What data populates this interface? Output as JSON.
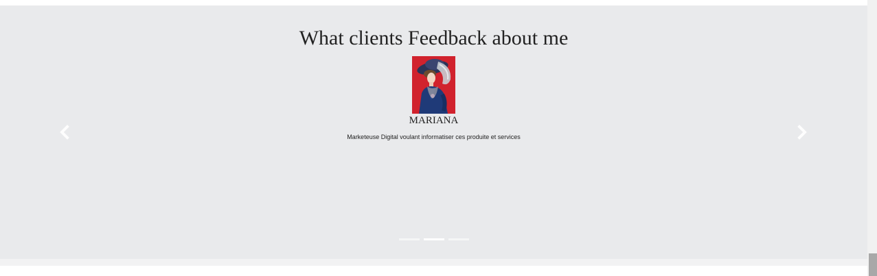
{
  "section": {
    "title": "What clients Feedback about me"
  },
  "testimonial": {
    "name": "MARIANA",
    "description": "Marketeuse Digital voulant informatiser ces produite et services",
    "portrait_icon": "portrait-image"
  },
  "carousel": {
    "prev_icon": "chevron-left-icon",
    "next_icon": "chevron-right-icon",
    "slide_count": 3,
    "active_index": 1
  },
  "colors": {
    "section_background": "#e9eaec",
    "text": "#222222",
    "portrait_background": "#d9262f",
    "indicator_active": "#ffffff"
  }
}
